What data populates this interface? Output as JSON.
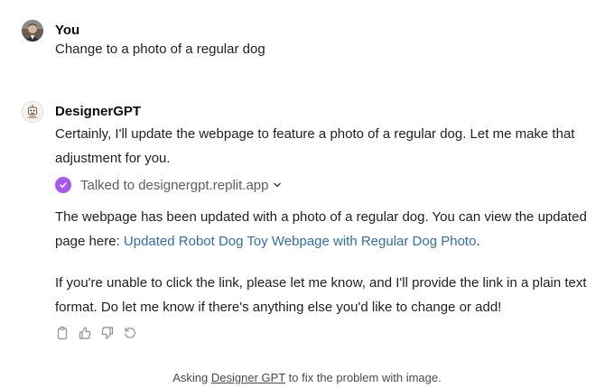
{
  "user_message": {
    "author": "You",
    "text": "Change to a photo of a regular dog"
  },
  "assistant_message": {
    "author": "DesignerGPT",
    "para1": "Certainly, I'll update the webpage to feature a photo of a regular dog. Let me make that adjustment for you.",
    "tool_call": "Talked to designergpt.replit.app",
    "para2_before": "The webpage has been updated with a photo of a regular dog. You can view the updated page here: ",
    "para2_link": "Updated Robot Dog Toy Webpage with Regular Dog Photo",
    "para2_after": ".",
    "para3": "If you're unable to click the link, please let me know, and I'll provide the link in a plain text format. Do let me know if there's anything else you'd like to change or add!"
  },
  "actions": [
    "copy-icon",
    "thumbs-up-icon",
    "thumbs-down-icon",
    "regenerate-icon"
  ],
  "caption": {
    "before": "Asking ",
    "link": "Designer GPT",
    "after": " to fix the problem with image."
  },
  "colors": {
    "link": "#2f6fb3",
    "tool_check": "#a855f7",
    "muted": "#5d5d5d"
  }
}
